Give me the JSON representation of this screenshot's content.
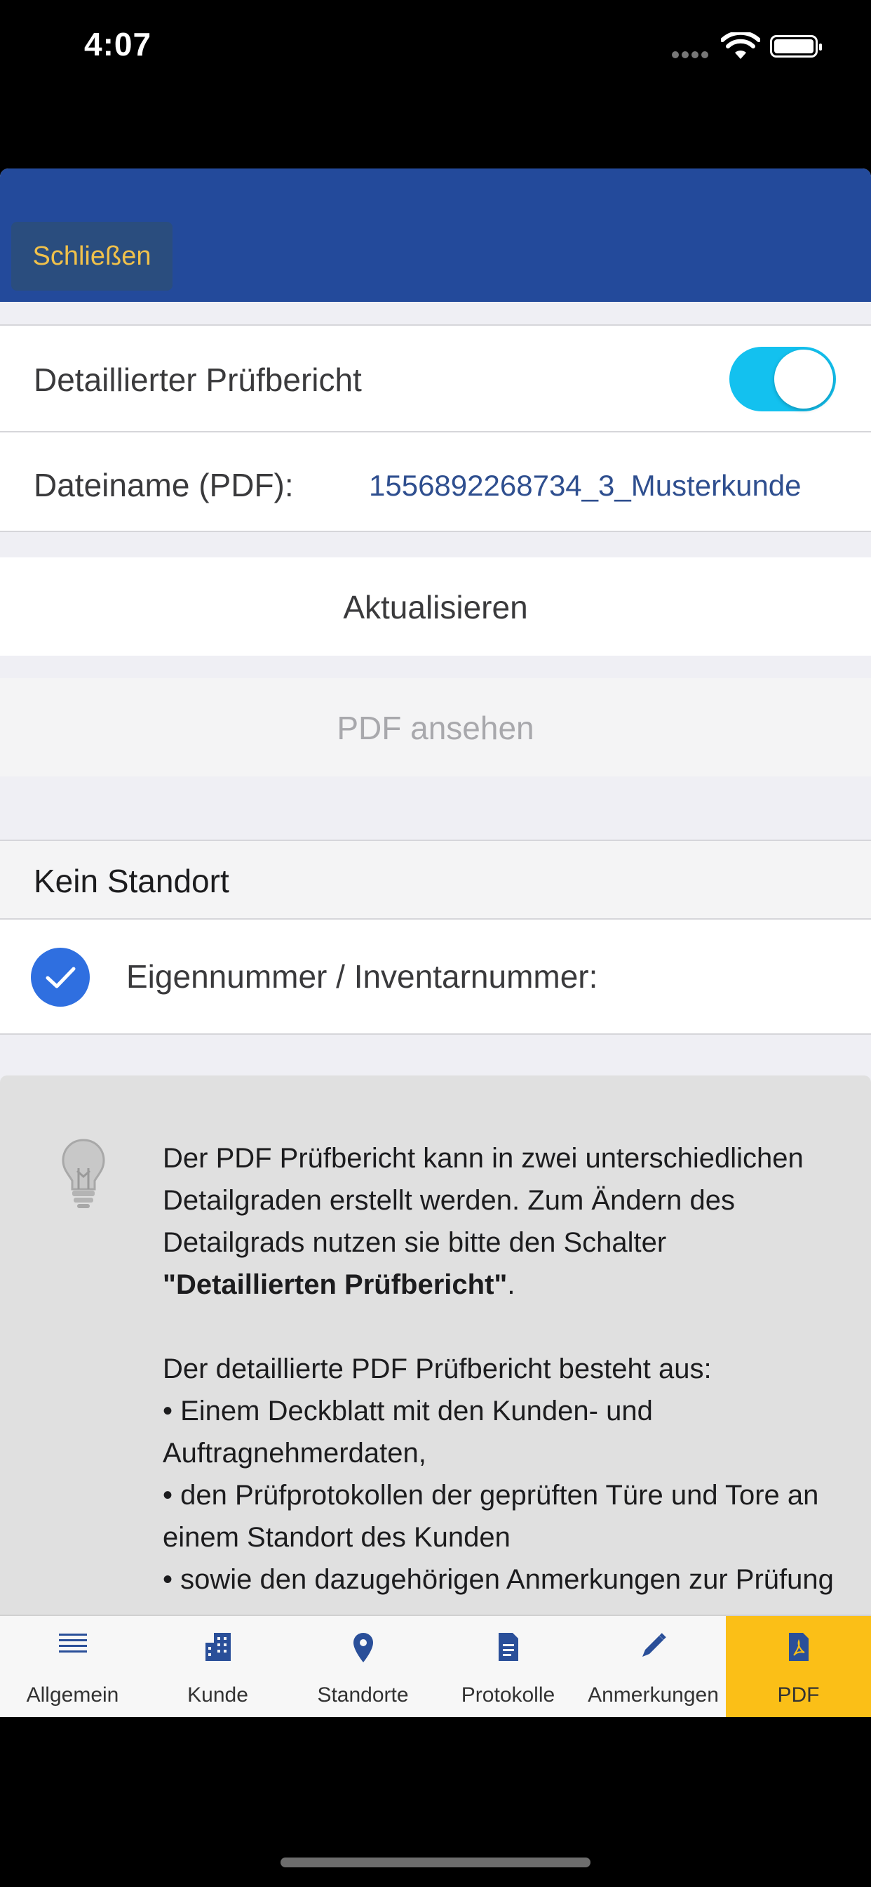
{
  "status_bar": {
    "time": "4:07"
  },
  "header": {
    "close_label": "Schließen"
  },
  "form": {
    "detailed_label": "Detaillierter Prüfbericht",
    "detailed_enabled": true,
    "filename_label": "Dateiname (PDF):",
    "filename_value": "1556892268734_3_Musterkunde"
  },
  "actions": {
    "update_label": "Aktualisieren",
    "view_pdf_label": "PDF ansehen"
  },
  "location": {
    "section_title": "Kein Standort",
    "item_label": "Eigennummer / Inventarnummer:"
  },
  "info": {
    "p1_before": "Der PDF Prüfbericht kann in zwei unterschiedlichen Detailgraden erstellt werden. Zum Ändern des Detailgrads nutzen sie bitte den Schalter ",
    "p1_bold": "\"Detaillierten Prüfbericht\"",
    "p1_after": ".",
    "p2_intro": "Der detaillierte PDF Prüfbericht besteht aus:",
    "bullet1": "• Einem Deckblatt mit den Kunden- und Auftragnehmerdaten,",
    "bullet2": "• den Prüfprotokollen der geprüften Türe und Tore an einem Standort des Kunden",
    "bullet3": "• sowie den dazugehörigen Anmerkungen zur Prüfung"
  },
  "tabs": [
    {
      "label": "Allgemein",
      "icon": "list-icon"
    },
    {
      "label": "Kunde",
      "icon": "building-icon"
    },
    {
      "label": "Standorte",
      "icon": "location-pin-icon"
    },
    {
      "label": "Protokolle",
      "icon": "document-icon"
    },
    {
      "label": "Anmerkungen",
      "icon": "pencil-icon"
    },
    {
      "label": "PDF",
      "icon": "pdf-icon"
    }
  ],
  "active_tab": "PDF",
  "colors": {
    "header": "#234a9b",
    "close_text": "#f0c14b",
    "toggle_on": "#13c1ef",
    "link_text": "#2f4f8f",
    "check": "#2f6fe0",
    "tab_active": "#fbbf17",
    "tab_icon": "#2a4f99"
  }
}
